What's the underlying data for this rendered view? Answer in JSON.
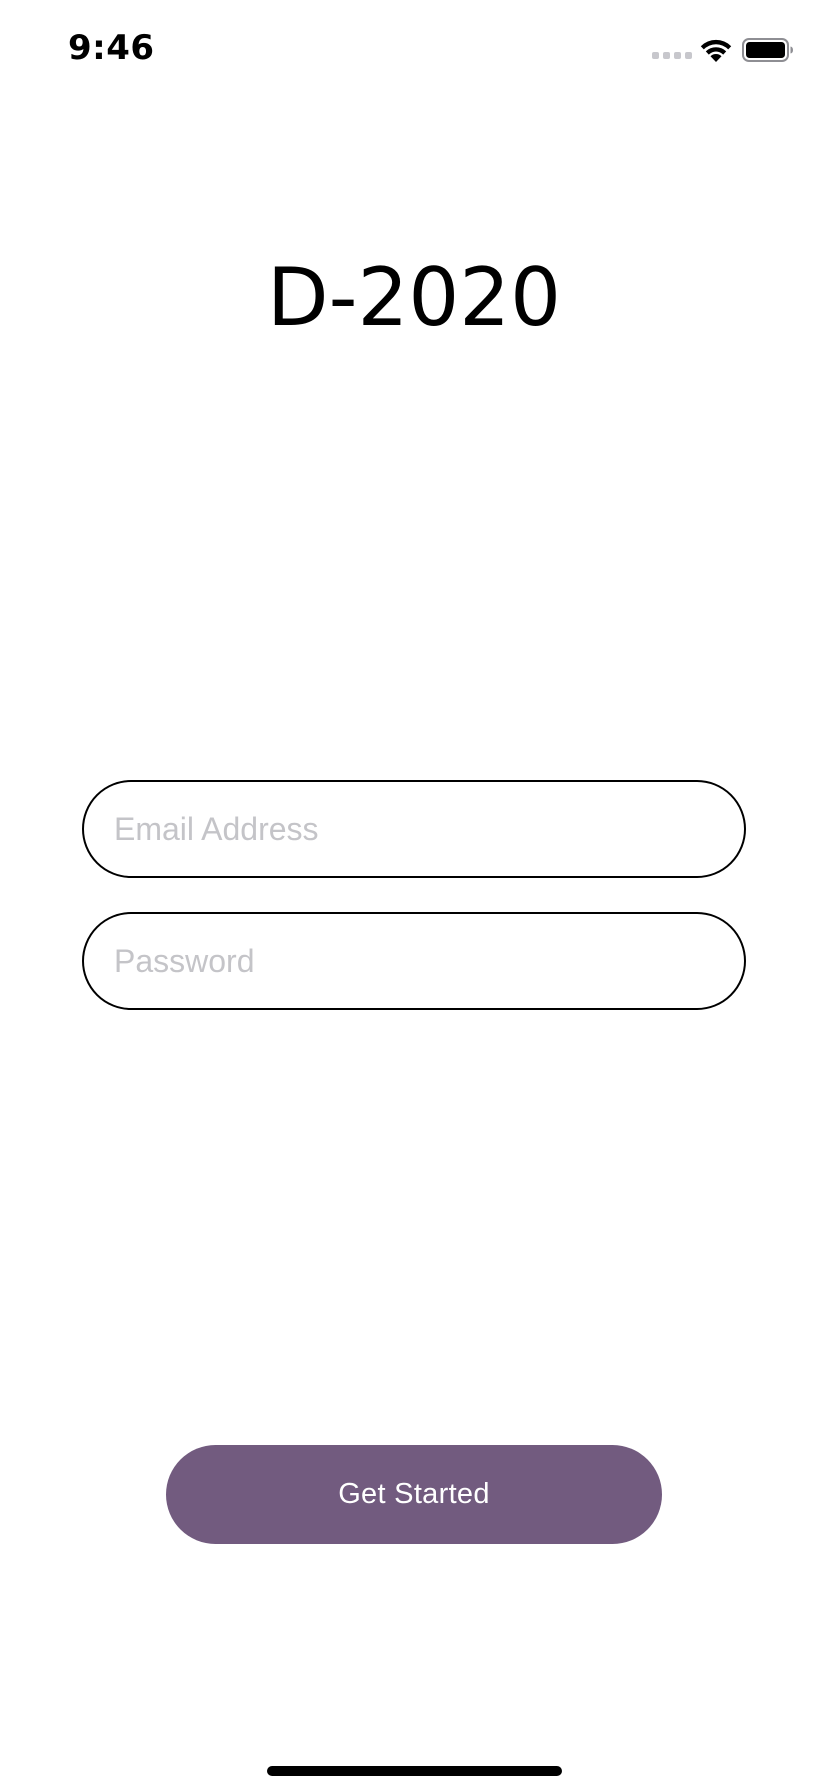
{
  "status_bar": {
    "time": "9:46",
    "icons": [
      "signal-icon",
      "wifi-icon",
      "battery-icon"
    ]
  },
  "app": {
    "title": "D-2020"
  },
  "form": {
    "email": {
      "placeholder": "Email Address",
      "value": ""
    },
    "password": {
      "placeholder": "Password",
      "value": ""
    }
  },
  "actions": {
    "get_started_label": "Get Started"
  },
  "colors": {
    "accent": "#725b7f",
    "placeholder": "#c4c4c8",
    "border": "#000000",
    "background": "#ffffff"
  }
}
